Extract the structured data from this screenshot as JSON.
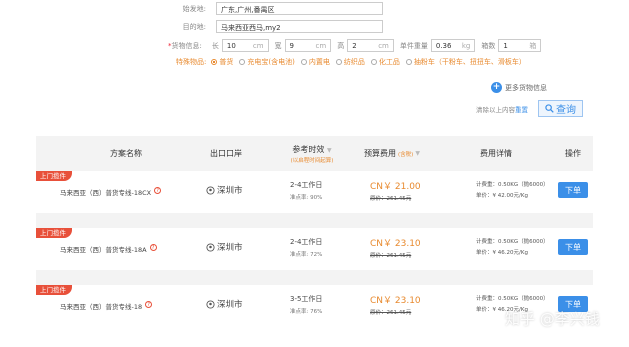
{
  "form": {
    "origin_label": "始发地:",
    "origin_value": "广东,广州,番禺区",
    "dest_label": "目的地:",
    "dest_value": "马来西亚西马,my2",
    "cargo_req": "*",
    "cargo_label": "货物信息:",
    "length_label": "长",
    "length_value": "10",
    "width_label": "宽",
    "width_value": "9",
    "height_label": "高",
    "height_value": "2",
    "cm_unit": "cm",
    "weight_label": "单件重量",
    "weight_value": "0.36",
    "kg_unit": "kg",
    "count_label": "箱数",
    "count_value": "1",
    "box_unit": "箱",
    "goods_label": "特殊物品:",
    "goods_options": [
      "普货",
      "充电宝(含电池)",
      "内置电",
      "纺织品",
      "化工品",
      "抽粉车（干粉车、扭扭车、滑板车）"
    ],
    "goods_selected": 0
  },
  "more_label": "更多货物信息",
  "clear_text": "清除以上内容",
  "clear_link": "重置",
  "search_label": "查询",
  "table": {
    "headers": {
      "plan": "方案名称",
      "port": "出口口岸",
      "time": "参考时效",
      "time_sub": "(以启程时间起算)",
      "fee": "预算费用",
      "fee_sub": "(含税)",
      "detail": "费用详情",
      "op": "操作"
    },
    "rows": [
      {
        "badge": "上门揽件",
        "name": "马来西亚（西）普货专线-18CX",
        "port": "深圳市",
        "time": "2-4工作日",
        "rate": "准点率: 90%",
        "price": "CN￥ 21.00",
        "orig": "原价：261.45元",
        "charge": "计费重：0.50KG（抛6000）",
        "unit": "单价：¥  42.00元/Kg",
        "btn": "下单"
      },
      {
        "badge": "上门揽件",
        "name": "马来西亚（西）普货专线-18A",
        "port": "深圳市",
        "time": "2-4工作日",
        "rate": "准点率: 72%",
        "price": "CN￥ 23.10",
        "orig": "原价：261.45元",
        "charge": "计费重：0.50KG（抛6000）",
        "unit": "单价：¥  46.20元/Kg",
        "btn": "下单"
      },
      {
        "badge": "上门揽件",
        "name": "马来西亚（西）普货专线-18",
        "port": "深圳市",
        "time": "3-5工作日",
        "rate": "准点率: 76%",
        "price": "CN￥ 23.10",
        "orig": "原价：261.45元",
        "charge": "计费重：0.50KG（抛6000）",
        "unit": "单价：¥  46.20元/Kg",
        "btn": "下单"
      }
    ]
  },
  "watermark": "知乎 @李兴钱",
  "colors": {
    "accent": "#3b8fe8",
    "orange": "#e88a2f",
    "badge": "#e8503a"
  }
}
